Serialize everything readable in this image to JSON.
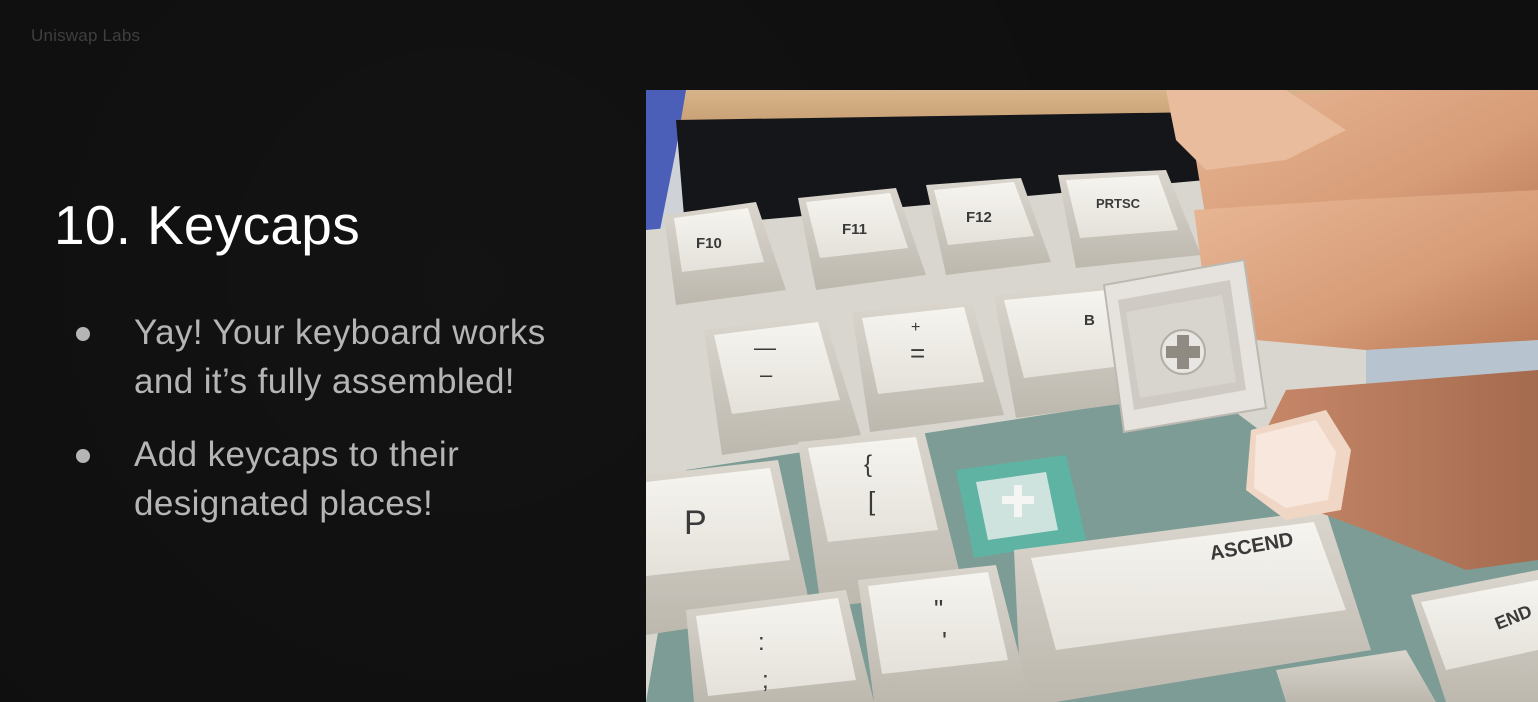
{
  "brand": "Uniswap Labs",
  "title": "10. Keycaps",
  "bullets": [
    "Yay! Your keyboard works and it’s fully assembled!",
    "Add keycaps to their designated places!"
  ],
  "photo": {
    "keycap_legends": {
      "f10": "F10",
      "f11": "F11",
      "f12": "F12",
      "prtsc": "PRTSC",
      "backspace_partial": "B",
      "minus_top": "—",
      "minus_bottom": "–",
      "equals_top": "+",
      "equals_bottom": "=",
      "p": "P",
      "bracket_top": "{",
      "bracket_bottom": "[",
      "quote_top": "\"",
      "quote_bottom": "'",
      "semicolon_top": ":",
      "semicolon_bottom": ";",
      "ascend": "ASCEND",
      "end": "END"
    }
  }
}
